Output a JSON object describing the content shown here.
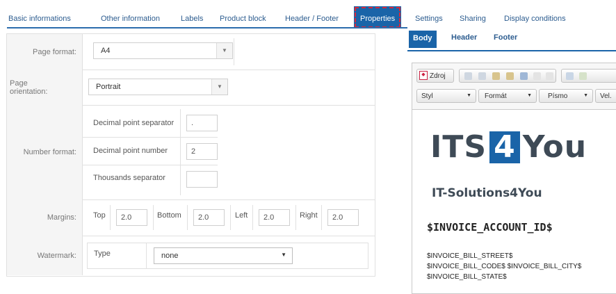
{
  "tabs": [
    {
      "label": "Basic informations"
    },
    {
      "label": "Other information"
    },
    {
      "label": "Labels"
    },
    {
      "label": "Product block"
    },
    {
      "label": "Header / Footer"
    },
    {
      "label": "Properties",
      "active": true
    },
    {
      "label": "Settings"
    },
    {
      "label": "Sharing"
    },
    {
      "label": "Display conditions"
    }
  ],
  "form": {
    "page_format": {
      "label": "Page format:",
      "value": "A4"
    },
    "page_orientation": {
      "label": "Page orientation:",
      "value": "Portrait"
    },
    "number_format": {
      "label": "Number format:",
      "decimal_separator": {
        "label": "Decimal point separator",
        "value": "."
      },
      "decimal_number": {
        "label": "Decimal point number",
        "value": "2"
      },
      "thousands_separator": {
        "label": "Thousands separator",
        "value": ""
      }
    },
    "margins": {
      "label": "Margins:",
      "top": {
        "label": "Top",
        "value": "2.0"
      },
      "bottom": {
        "label": "Bottom",
        "value": "2.0"
      },
      "left": {
        "label": "Left",
        "value": "2.0"
      },
      "right": {
        "label": "Right",
        "value": "2.0"
      }
    },
    "watermark": {
      "label": "Watermark:",
      "type_label": "Type",
      "type_value": "none"
    }
  },
  "editor": {
    "tabs": [
      {
        "label": "Body",
        "active": true
      },
      {
        "label": "Header"
      },
      {
        "label": "Footer"
      }
    ],
    "toolbar": {
      "source_label": "Zdroj",
      "style_label": "Styl",
      "format_label": "Formát",
      "font_label": "Písmo",
      "size_label": "Vel."
    },
    "content": {
      "logo_left": "ITS",
      "logo_box": "4",
      "logo_right": "You",
      "slogan": "IT-Solutions4You",
      "account_id": "$INVOICE_ACCOUNT_ID$",
      "bill_street": "$INVOICE_BILL_STREET$",
      "bill_code_city": "$INVOICE_BILL_CODE$ $INVOICE_BILL_CITY$",
      "bill_state": "$INVOICE_BILL_STATE$"
    }
  },
  "colors": {
    "accent": "#1a64a8",
    "highlight_border": "#d6283c",
    "tab_text": "#2c5c8f"
  }
}
